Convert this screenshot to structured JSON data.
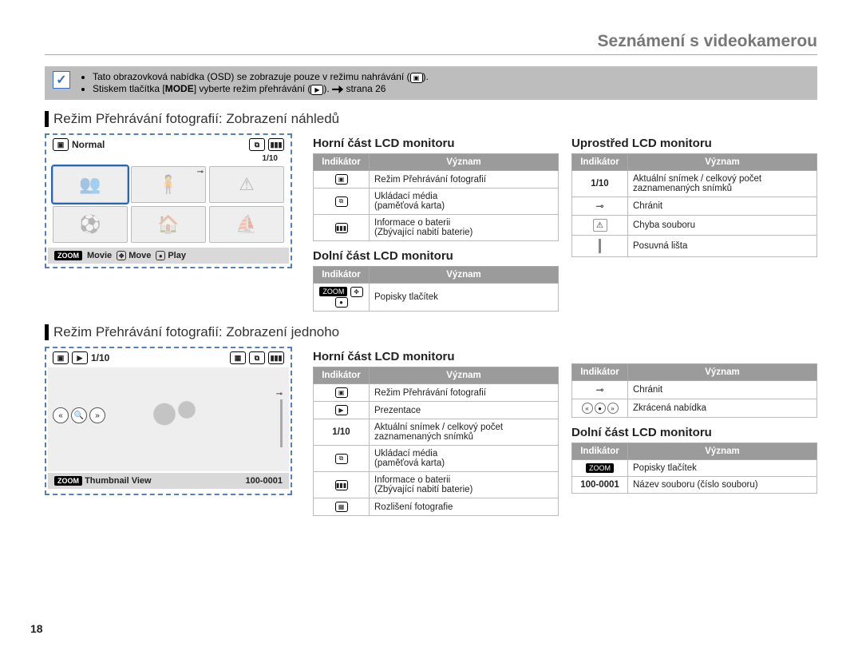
{
  "page": {
    "number": "18",
    "title": "Seznámení s videokamerou"
  },
  "infobox": {
    "line1": "Tato obrazovková nabídka (OSD) se zobrazuje pouze v režimu nahrávání (",
    "line1b": ").",
    "line2a": "Stiskem tlačítka [",
    "line2mode": "MODE",
    "line2b": "] vyberte režim přehrávání (",
    "line2c": "). ",
    "line2d": "strana 26"
  },
  "section1": {
    "title": "Režim Přehrávání fotografií: Zobrazení náhledů"
  },
  "section2": {
    "title": "Režim Přehrávání fotografií: Zobrazení jednoho"
  },
  "lcd1": {
    "normal": "Normal",
    "counter": "1/10",
    "bot": {
      "zoom": "ZOOM",
      "movie": "Movie",
      "move": "Move",
      "play": "Play"
    }
  },
  "lcd2": {
    "counter": "1/10",
    "bot": {
      "zoom": "ZOOM",
      "thumb": "Thumbnail View",
      "file": "100-0001"
    }
  },
  "headers": {
    "ind": "Indikátor",
    "mean": "Význam"
  },
  "subheads": {
    "top": "Horní část LCD monitoru",
    "mid": "Uprostřed LCD monitoru",
    "bot": "Dolní část LCD monitoru"
  },
  "t_top1": {
    "r1": "Režim Přehrávání fotografií",
    "r2": "Ukládací média\n(paměťová karta)",
    "r3": "Informace o baterii\n(Zbývající nabití baterie)"
  },
  "t_bot1": {
    "r1": "Popisky tlačítek"
  },
  "t_mid1": {
    "r1_i": "1/10",
    "r1": "Aktuální snímek / celkový počet zaznamenaných snímků",
    "r2": "Chránit",
    "r3": "Chyba souboru",
    "r4": "Posuvná lišta"
  },
  "t_top2": {
    "r1": "Režim Přehrávání fotografií",
    "r2": "Prezentace",
    "r3_i": "1/10",
    "r3": "Aktuální snímek / celkový počet zaznamenaných snímků",
    "r4": "Ukládací média\n(paměťová karta)",
    "r5": "Informace o baterii\n(Zbývající nabití baterie)",
    "r6": "Rozlišení fotografie"
  },
  "t_right2a": {
    "r1": "Chránit",
    "r2": "Zkrácená nabídka"
  },
  "t_right2b": {
    "r1_i": "ZOOM",
    "r1": "Popisky tlačítek",
    "r2_i": "100-0001",
    "r2": "Název souboru (číslo souboru)"
  }
}
